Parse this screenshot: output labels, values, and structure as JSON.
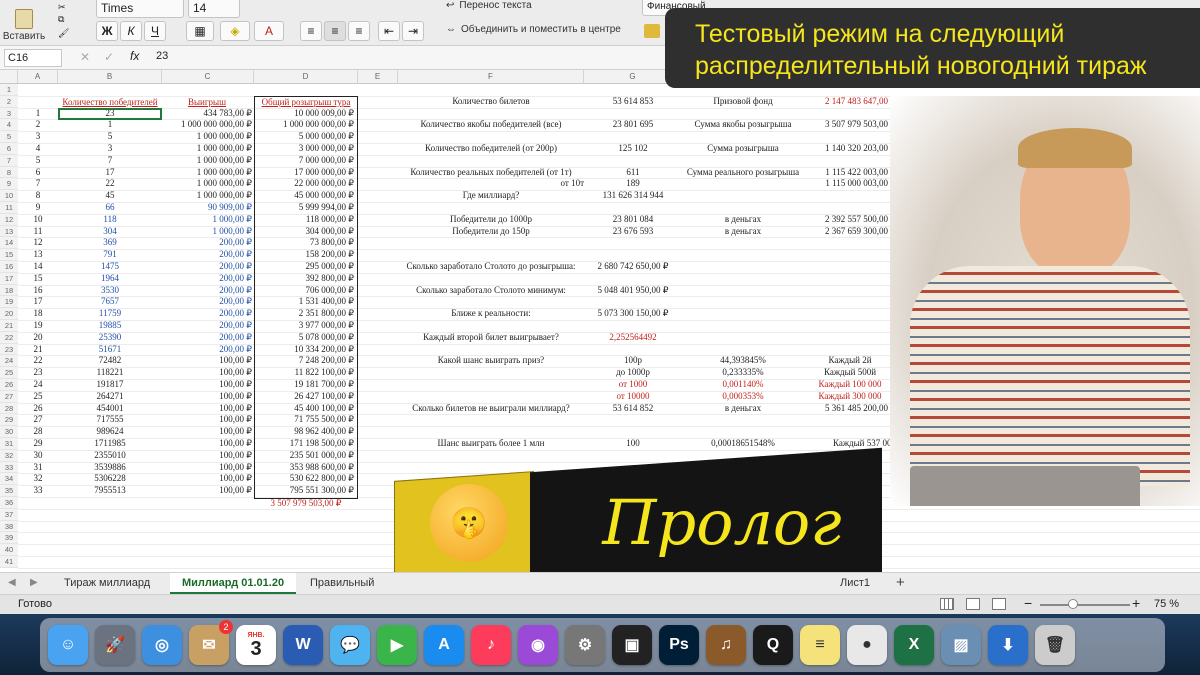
{
  "toolbar": {
    "paste_label": "Вставить",
    "font_name": "Times",
    "font_size": "14",
    "bold": "Ж",
    "italic": "К",
    "underline": "Ч",
    "wrap_text": "Перенос текста",
    "merge_center": "Объединить и поместить в центре",
    "number_format": "Финансовый"
  },
  "formula_bar": {
    "cell_ref": "C16",
    "value": "23"
  },
  "columns": [
    "A",
    "B",
    "C",
    "D",
    "E",
    "F",
    "G",
    "H",
    "I"
  ],
  "table": {
    "header": [
      "Количество победителей",
      "Выигрыш",
      "Общий розыгрыш тура"
    ],
    "rows": [
      [
        "1",
        "23",
        "434 783,00 ₽",
        "10 000 009,00 ₽"
      ],
      [
        "2",
        "1",
        "1 000 000 000,00 ₽",
        "1 000 000 000,00 ₽"
      ],
      [
        "3",
        "5",
        "1 000 000,00 ₽",
        "5 000 000,00 ₽"
      ],
      [
        "4",
        "3",
        "1 000 000,00 ₽",
        "3 000 000,00 ₽"
      ],
      [
        "5",
        "7",
        "1 000 000,00 ₽",
        "7 000 000,00 ₽"
      ],
      [
        "6",
        "17",
        "1 000 000,00 ₽",
        "17 000 000,00 ₽"
      ],
      [
        "7",
        "22",
        "1 000 000,00 ₽",
        "22 000 000,00 ₽"
      ],
      [
        "8",
        "45",
        "1 000 000,00 ₽",
        "45 000 000,00 ₽"
      ],
      [
        "9",
        "66",
        "90 909,00 ₽",
        "5 999 994,00 ₽"
      ],
      [
        "10",
        "118",
        "1 000,00 ₽",
        "118 000,00 ₽"
      ],
      [
        "11",
        "304",
        "1 000,00 ₽",
        "304 000,00 ₽"
      ],
      [
        "12",
        "369",
        "200,00 ₽",
        "73 800,00 ₽"
      ],
      [
        "13",
        "791",
        "200,00 ₽",
        "158 200,00 ₽"
      ],
      [
        "14",
        "1475",
        "200,00 ₽",
        "295 000,00 ₽"
      ],
      [
        "15",
        "1964",
        "200,00 ₽",
        "392 800,00 ₽"
      ],
      [
        "16",
        "3530",
        "200,00 ₽",
        "706 000,00 ₽"
      ],
      [
        "17",
        "7657",
        "200,00 ₽",
        "1 531 400,00 ₽"
      ],
      [
        "18",
        "11759",
        "200,00 ₽",
        "2 351 800,00 ₽"
      ],
      [
        "19",
        "19885",
        "200,00 ₽",
        "3 977 000,00 ₽"
      ],
      [
        "20",
        "25390",
        "200,00 ₽",
        "5 078 000,00 ₽"
      ],
      [
        "21",
        "51671",
        "200,00 ₽",
        "10 334 200,00 ₽"
      ],
      [
        "22",
        "72482",
        "100,00 ₽",
        "7 248 200,00 ₽"
      ],
      [
        "23",
        "118221",
        "100,00 ₽",
        "11 822 100,00 ₽"
      ],
      [
        "24",
        "191817",
        "100,00 ₽",
        "19 181 700,00 ₽"
      ],
      [
        "25",
        "264271",
        "100,00 ₽",
        "26 427 100,00 ₽"
      ],
      [
        "26",
        "454001",
        "100,00 ₽",
        "45 400 100,00 ₽"
      ],
      [
        "27",
        "717555",
        "100,00 ₽",
        "71 755 500,00 ₽"
      ],
      [
        "28",
        "989624",
        "100,00 ₽",
        "98 962 400,00 ₽"
      ],
      [
        "29",
        "1711985",
        "100,00 ₽",
        "171 198 500,00 ₽"
      ],
      [
        "30",
        "2355010",
        "100,00 ₽",
        "235 501 000,00 ₽"
      ],
      [
        "31",
        "3539886",
        "100,00 ₽",
        "353 988 600,00 ₽"
      ],
      [
        "32",
        "5306228",
        "100,00 ₽",
        "530 622 800,00 ₽"
      ],
      [
        "33",
        "7955513",
        "100,00 ₽",
        "795 551 300,00 ₽"
      ]
    ],
    "total": "3 507 979 503,00 ₽"
  },
  "stats": {
    "total_tickets_label": "Количество билетов",
    "total_tickets": "53 614 853",
    "prize_fund_label": "Призовой фонд",
    "prize_fund": "2 147 483 647,00 ₽",
    "supposed_winners_label": "Количество якобы победителей (все)",
    "supposed_winners": "23 801 695",
    "supposed_sum_label": "Сумма якобы розыгрыша",
    "supposed_sum": "3 507 979 503,00 ₽",
    "winners_200_label": "Количество победителей (от 200р)",
    "winners_200": "125 102",
    "draw_sum_label": "Сумма розыгрыша",
    "draw_sum": "1 140 320 203,00 ₽",
    "real_winners_label": "Количество реальных победителей (от 1т)",
    "real_winners": "611",
    "real_draw_sum_label": "Сумма реального розыгрыша",
    "real_draw_sum": "1 115 422 003,00 ₽",
    "from_10t_label": "от 10т",
    "from_10t": "189",
    "from_10t_sum": "1 115 000 003,00 ₽",
    "billion_where_label": "Где миллиард?",
    "billion_where": "131 626 314 944",
    "winners_1000_label": "Победители до 1000р",
    "winners_1000": "23 801 084",
    "in_money_1": "в деньгах",
    "winners_1000_sum": "2 392 557 500,00 ₽",
    "winners_150_label": "Победители до 150р",
    "winners_150": "23 676 593",
    "in_money_2": "в деньгах",
    "winners_150_sum": "2 367 659 300,00 ₽",
    "earned_before_label": "Сколько заработало Столото до розыгрыша:",
    "earned_before": "2 680 742 650,00 ₽",
    "earned_min_label": "Сколько заработало Столото минимум:",
    "earned_min": "5 048 401 950,00 ₽",
    "closer_label": "Ближе к реальности:",
    "closer": "5 073 300 150,00 ₽",
    "every_second_label": "Каждый второй билет выигрывает?",
    "every_second": "2,252564492",
    "chance_label": "Какой шанс выиграть приз?",
    "chances": [
      [
        "100р",
        "44,393845%",
        "Каждый 2й"
      ],
      [
        "до 1000р",
        "0,233335%",
        "Каждый 500й"
      ],
      [
        "от 1000",
        "0,001140%",
        "Каждый 100 000"
      ],
      [
        "от 10000",
        "0,000353%",
        "Каждый 300 000"
      ]
    ],
    "not_won_label": "Сколько билетов не выиграли миллиард?",
    "not_won": "53 614 852",
    "in_money_3": "в деньгах",
    "not_won_sum": "5 361 485 200,00 ₽",
    "million_label": "Шанс выиграть более 1 млн",
    "million": "100",
    "million_pct": "0,00018651548%",
    "million_every": "Каждый 537 000"
  },
  "sheet_tabs": [
    "Тираж миллиард",
    "Миллиард 01.01.20",
    "Правильный розыгрыш",
    "Лист1"
  ],
  "status": {
    "ready": "Готово",
    "zoom": "75 %"
  },
  "overlay": {
    "banner": "Тестовый режим на следующий распределительный новогодний тираж",
    "logo": "Пролог"
  },
  "dock": [
    "Finder",
    "Launchpad",
    "Safari",
    "Mail",
    "Calendar",
    "Word",
    "Messages",
    "FaceTime",
    "App Store",
    "Music",
    "Podcasts",
    "System Preferences",
    "Final Cut",
    "Photoshop",
    "Instruments",
    "QuickTime",
    "Notes",
    "Chrome",
    "Excel",
    "Preview",
    "Downloads",
    "Trash"
  ],
  "calendar": {
    "month": "ЯНВ.",
    "day": "3"
  },
  "mail_badge": "2"
}
